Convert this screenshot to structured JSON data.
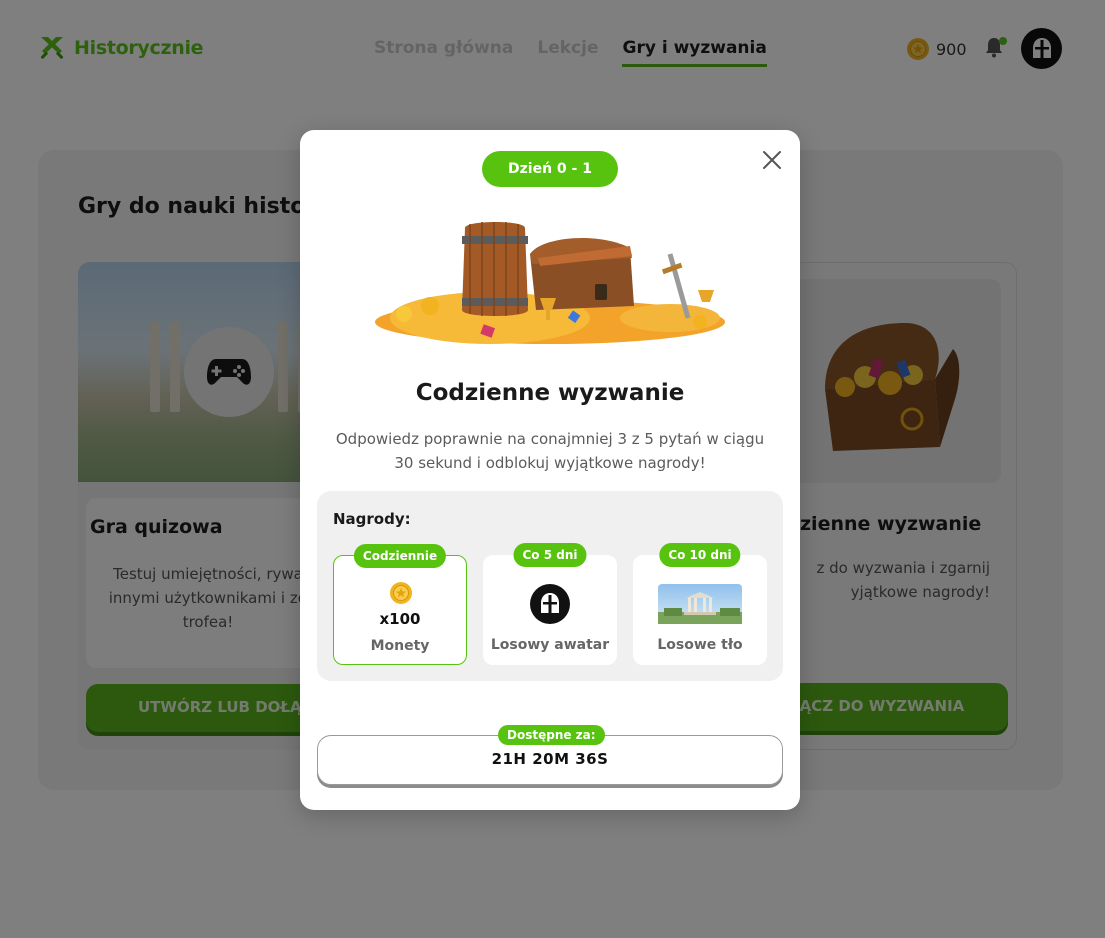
{
  "header": {
    "brand": "Historycznie",
    "nav": [
      {
        "label": "Strona główna"
      },
      {
        "label": "Lekcje"
      },
      {
        "label": "Gry i wyzwania"
      }
    ],
    "coins": "900",
    "accent_color": "#58b31c"
  },
  "page": {
    "title": "Gry do nauki histor",
    "quiz_card": {
      "title": "Gra quizowa",
      "description": "Testuj umiejętności, rywa innymi użytkownikami i zd trofea!",
      "button": "UTWÓRZ LUB DOŁĄ"
    },
    "challenge_card": {
      "title": "zienne wyzwanie",
      "description": "z do wyzwania i zgarnij yjątkowe nagrody!",
      "button": "ŁĄCZ DO WYZWANIA"
    }
  },
  "modal": {
    "day_badge": "Dzień 0 - 1",
    "title": "Codzienne wyzwanie",
    "description": "Odpowiedz poprawnie na conajmniej 3 z 5 pytań w ciągu 30 sekund i odblokuj wyjątkowe nagrody!",
    "rewards_title": "Nagrody:",
    "rewards": [
      {
        "frequency": "Codziennie",
        "quantity": "x100",
        "name": "Monety",
        "icon": "coin-icon"
      },
      {
        "frequency": "Co 5 dni",
        "quantity": "",
        "name": "Losowy awatar",
        "icon": "avatar-icon"
      },
      {
        "frequency": "Co 10 dni",
        "quantity": "",
        "name": "Losowe tło",
        "icon": "background-image"
      }
    ],
    "timer_label": "Dostępne za:",
    "timer_value": "21H 20M 36S"
  }
}
